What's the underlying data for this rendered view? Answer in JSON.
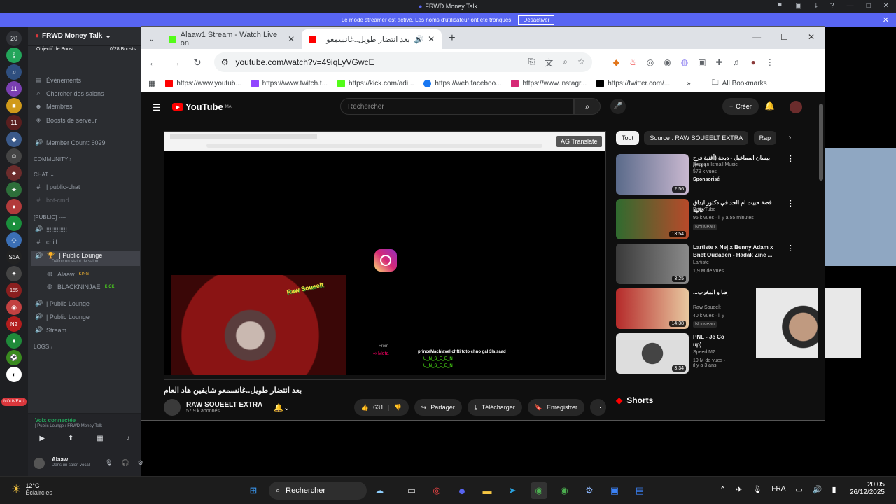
{
  "discord": {
    "title": "FRWD Money Talk",
    "streamer_banner": "Le mode streamer est activé. Les noms d'utilisateur ont été tronqués.",
    "streamer_button": "Désactiver",
    "guild_name": "FRWD Money Talk",
    "boost_label": "Objectif de Boost",
    "boost_count": "0/28 Boosts",
    "items": {
      "events": "Événements",
      "search": "Chercher des salons",
      "members": "Membres",
      "boosts": "Boosts de serveur",
      "member_count": "Member Count: 6029",
      "community": "COMMUNITY",
      "chat": "CHAT",
      "public_chat": "| public-chat",
      "bot_cmd": "bot-cmd",
      "public_cat": "[PUBLIC] ----",
      "dots": "!!!!!!!!!!!!",
      "chill": "chill",
      "public_lounge": "| Public Lounge",
      "lounge_status": "Définir un statut de salon",
      "user1": "Alaaw",
      "user1_badge": "KING",
      "user2": "BLACKNINJAE",
      "user2_badge": "KICK",
      "public_lounge2": "| Public Lounge",
      "public_lounge3": "| Public Lounge",
      "stream": "Stream",
      "logs": "LOGS"
    },
    "voice_status": "Voix connectée",
    "voice_channel": "| Public Lounge / FRWD Money Talk",
    "user_name": "Alaaw",
    "user_status": "Dans un salon vocal",
    "server_badges": [
      "20",
      "11",
      "11",
      "155",
      "NOUVEAU"
    ]
  },
  "browser": {
    "tabs": [
      {
        "label": "Alaaw1 Stream - Watch Live on",
        "active": false
      },
      {
        "label": "بعد انتضار طويل..غانسمعو",
        "active": true
      }
    ],
    "url": "youtube.com/watch?v=49iqLyVGwcE",
    "bookmarks": [
      "https://www.youtub...",
      "https://www.twitch.t...",
      "https://kick.com/adi...",
      "https://web.faceboo...",
      "https://www.instagr...",
      "https://twitter.com/..."
    ],
    "all_bookmarks": "All Bookmarks"
  },
  "youtube": {
    "logo": "YouTube",
    "region": "MA",
    "search_placeholder": "Rechercher",
    "create": "Créer",
    "translate": "AG Translate",
    "video_title": "بعد انتضار طويل..غانسمعو شايفين هاد العام",
    "channel": "RAW SOUEELT EXTRA",
    "subscribers": "57,9 k abonnés",
    "likes": "631",
    "share": "Partager",
    "download": "Télécharger",
    "save": "Enregistrer",
    "overlay_from": "From",
    "overlay_meta": "Meta",
    "chat_line": "princeMachiavel  chfti toto chno gal 3la saad",
    "chat_name1": "U_N_S_E_E_N",
    "chat_name2": "U_N_S_E_E_N",
    "chips": [
      "Tout",
      "Source : RAW SOUEELT EXTRA",
      "Rap"
    ],
    "recs": [
      {
        "title": "بيسان اسماعيل - دبحة (أغنية فرح ٢٠٢١)",
        "channel": "Bessan Ismail Music",
        "meta": "579 k vues",
        "badge": "Sponsorisé",
        "dur": "2:56"
      },
      {
        "title": "قصة حبيت ام الجد في دكتور ايداق عالية",
        "channel": "BarryTube",
        "meta": "95 k vues · il y a 55 minutes",
        "badge": "Nouveau",
        "dur": "13:54"
      },
      {
        "title": "Lartiste x Nej x Benny Adam x Bnet Oudaden - Hadak Zine ...",
        "channel": "Lartiste",
        "meta": "1,9 M de vues",
        "badge": "",
        "dur": "3:25"
      },
      {
        "title": "...سعد المجرد و بعرضا و المغرب",
        "channel": "Raw Soueelt",
        "meta": "40 k vues · il y",
        "badge": "Nouveau",
        "dur": "14:38"
      },
      {
        "title": "PNL - Je Co up)",
        "channel": "Speed MZ",
        "meta": "19 M de vues · il y a 3 ans",
        "badge": "",
        "dur": "3:34"
      }
    ],
    "shorts": "Shorts"
  },
  "taskbar": {
    "temp": "12°C",
    "weather": "Éclaircies",
    "search": "Rechercher",
    "lang": "FRA",
    "time": "20:05",
    "date": "26/12/2025"
  }
}
